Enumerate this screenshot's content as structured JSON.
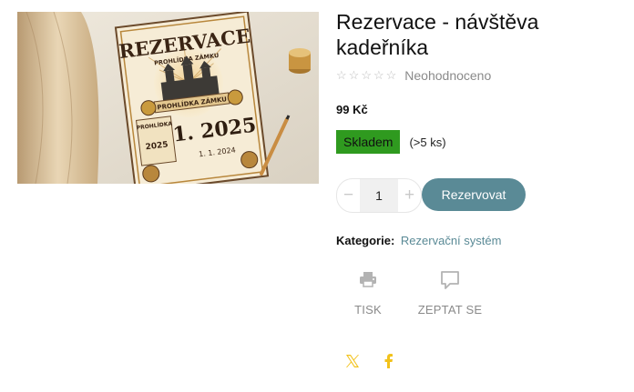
{
  "product": {
    "title": "Rezervace - návštěva kadeřníka",
    "image": {
      "headline": "REZERVACE",
      "subheadline": "PROHLÍDKA ZÁMKU",
      "banner": "PROHLÍDKA ZÁMKU",
      "left_label": "PROHLÍDKA",
      "big_date": "1. 2025",
      "left_year": "2025",
      "small_date": "1. 1. 2024"
    },
    "rating": {
      "stars_total": 5,
      "stars_filled": 0,
      "label": "Neohodnoceno"
    },
    "price": "99 Kč",
    "stock": {
      "badge": "Skladem",
      "count": "(>5 ks)",
      "badge_color": "#2f9a1f"
    },
    "quantity": {
      "value": "1",
      "minus": "−",
      "plus": "+"
    },
    "reserve_button": "Rezervovat",
    "category": {
      "label": "Kategorie:",
      "link": "Rezervační systém"
    }
  },
  "actions": {
    "print": {
      "label": "TISK",
      "icon": "printer-icon"
    },
    "ask": {
      "label": "ZEPTAT SE",
      "icon": "speech-bubble-icon"
    }
  },
  "share": {
    "twitter": "x-icon",
    "facebook": "facebook-icon",
    "color": "#f2c21b"
  },
  "colors": {
    "accent": "#5a8a96",
    "stock": "#2f9a1f",
    "muted": "#8a8a8a"
  }
}
